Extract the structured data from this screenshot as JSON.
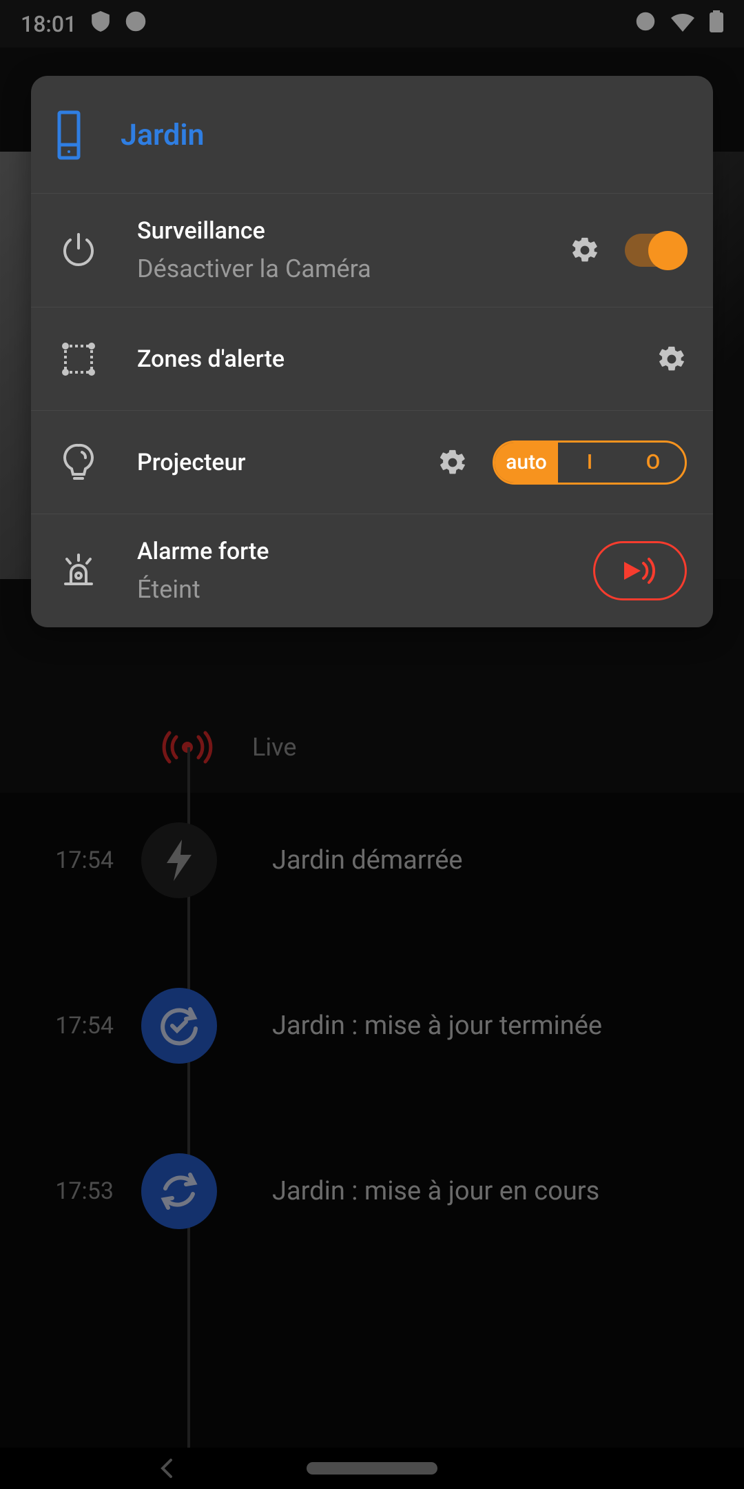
{
  "statusbar": {
    "time": "18:01"
  },
  "card": {
    "title": "Jardin",
    "surveillance": {
      "title": "Surveillance",
      "subtitle": "Désactiver la Caméra",
      "enabled": true
    },
    "zones": {
      "title": "Zones d'alerte"
    },
    "projector": {
      "title": "Projecteur",
      "options": [
        "auto",
        "I",
        "O"
      ],
      "selected_index": 0
    },
    "alarm": {
      "title": "Alarme forte",
      "subtitle": "Éteint"
    }
  },
  "timeline": {
    "live_label": "Live",
    "events": [
      {
        "time": "17:54",
        "label": "Jardin démarrée",
        "icon": "bolt",
        "style": "dark"
      },
      {
        "time": "17:54",
        "label": "Jardin : mise à jour terminée",
        "icon": "sync-check",
        "style": "blue"
      },
      {
        "time": "17:53",
        "label": "Jardin : mise à jour en cours",
        "icon": "sync",
        "style": "blue"
      }
    ]
  }
}
